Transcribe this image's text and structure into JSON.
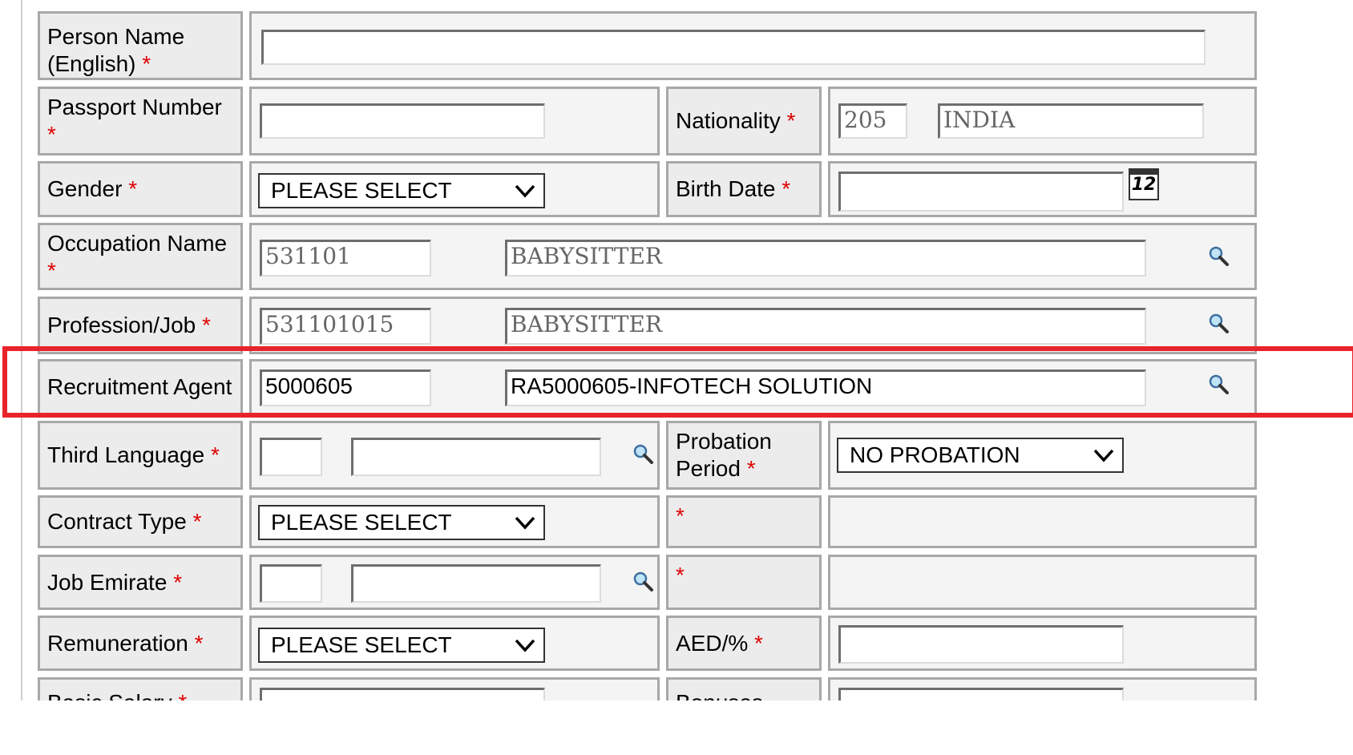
{
  "required_mark": "*",
  "fields": {
    "person_name": {
      "label": "Person Name (English)",
      "value": ""
    },
    "passport_number": {
      "label": "Passport Number",
      "value": ""
    },
    "nationality": {
      "label": "Nationality",
      "code": "205",
      "name": "INDIA"
    },
    "gender": {
      "label": "Gender",
      "selected": "PLEASE SELECT"
    },
    "birth_date": {
      "label": "Birth Date",
      "value": "",
      "calendar_icon_text": "12"
    },
    "occupation": {
      "label": "Occupation Name",
      "code": "531101",
      "name": "BABYSITTER"
    },
    "profession": {
      "label": "Profession/Job",
      "code": "531101015",
      "name": "BABYSITTER"
    },
    "recruitment_agent": {
      "label": "Recruitment Agent",
      "code": "5000605",
      "name": "RA5000605-INFOTECH SOLUTION"
    },
    "third_language": {
      "label": "Third Language",
      "code": "",
      "name": ""
    },
    "probation_period": {
      "label": "Probation Period",
      "selected": "NO PROBATION"
    },
    "contract_type": {
      "label": "Contract Type",
      "selected": "PLEASE SELECT"
    },
    "job_emirate": {
      "label": "Job Emirate",
      "code": "",
      "name": ""
    },
    "remuneration": {
      "label": "Remuneration",
      "selected": "PLEASE SELECT"
    },
    "aed_percent": {
      "label": "AED/%",
      "value": ""
    },
    "basic_salary": {
      "label": "Basic Salary"
    },
    "bonuses": {
      "label": "Bonuses"
    }
  },
  "highlight_color": "#e8242a",
  "icons": {
    "lookup": "magnifier-icon",
    "calendar": "calendar-icon",
    "dropdown": "chevron-down-icon"
  }
}
